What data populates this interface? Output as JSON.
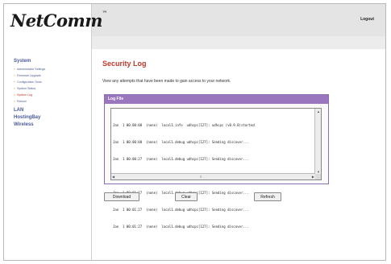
{
  "header": {
    "logo": "NetComm",
    "logo_tm": "™",
    "logout": "Logout"
  },
  "sidebar": {
    "system_heading": "System",
    "items": [
      {
        "label": "Administrator Settings",
        "active": false
      },
      {
        "label": "Firmware Upgrade",
        "active": false
      },
      {
        "label": "Configuration Tools",
        "active": false
      },
      {
        "label": "System Status",
        "active": false
      },
      {
        "label": "System Log",
        "active": true
      },
      {
        "label": "Reboot",
        "active": false
      }
    ],
    "lan": "LAN",
    "hosting": "HostingBay",
    "wireless": "Wireless"
  },
  "main": {
    "title": "Security Log",
    "description": "View any attempts that have been made to gain access to your network.",
    "panel_title": "Log File",
    "log_lines": [
      "Jan  1 00:00:08  (none)  local1.info  udhcpc[127]: udhcpc (v0.9.8)started",
      "Jan  1 00:00:08  (none)  local1.debug udhcpc[127]: Sending discover...",
      "Jan  1 00:00:27  (none)  local1.debug udhcpc[127]: Sending discover...",
      "Jan  1 00:00:08  (none)  syslog.debug udhcpc[127]: Sending discover...",
      "Jan  1 00:01:27  (none)  local1.debug udhcpc[127]: Sending discover...",
      "Jan  1 00:01:27  (none)  local1.debug udhcpc[127]: Sending discover...",
      "Jan  1 00:01:27  (none)  local1.debug udhcpc[127]: Sending discover..."
    ],
    "buttons": {
      "download": "Download",
      "clear": "Clear",
      "refresh": "Refresh"
    }
  },
  "colors": {
    "accent_title": "#c0392b",
    "panel_header": "#9a76bf",
    "nav_link": "#4a5b9a"
  }
}
